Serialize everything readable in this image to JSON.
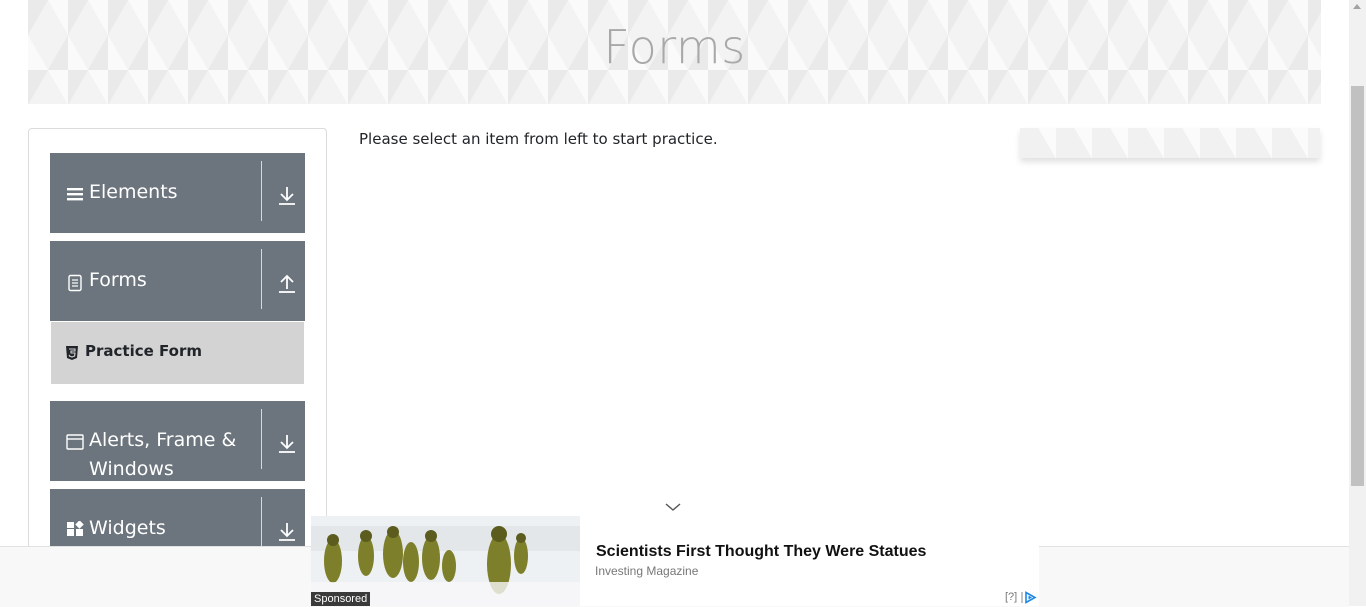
{
  "header": {
    "title": "Forms"
  },
  "sidebar": {
    "groups": [
      {
        "label": "Elements",
        "icon": "hamburger-icon",
        "toggle_icon": "expand-arrow-icon"
      },
      {
        "label": "Forms",
        "icon": "document-icon",
        "toggle_icon": "collapse-arrow-icon",
        "items": [
          {
            "label": "Practice Form",
            "icon": "html5-icon"
          }
        ]
      },
      {
        "label": "Alerts, Frame &",
        "label_line2": "Windows",
        "icon": "window-icon",
        "toggle_icon": "expand-arrow-icon"
      },
      {
        "label": "Widgets",
        "icon": "widgets-icon",
        "toggle_icon": "expand-arrow-icon"
      }
    ]
  },
  "main": {
    "message": "Please select an item from left to start practice."
  },
  "ad": {
    "sponsored_label": "Sponsored",
    "headline": "Scientists First Thought They Were Statues",
    "source": "Investing Magazine",
    "info_label": "[?]"
  },
  "colors": {
    "group_bg": "#6c757d",
    "active_item_bg": "#d3d3d3",
    "accent": "#1e88e5"
  }
}
